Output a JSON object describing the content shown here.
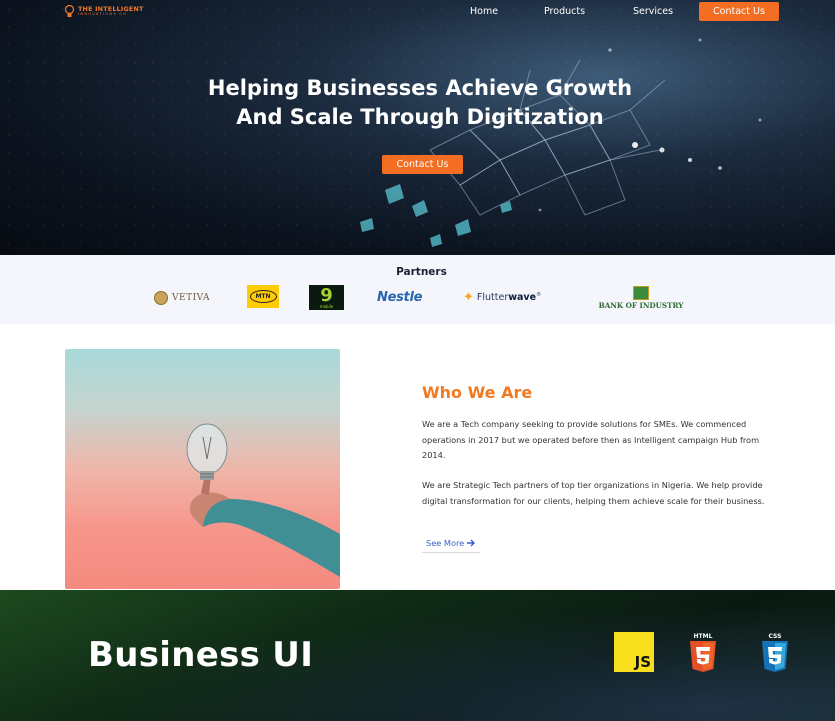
{
  "nav": {
    "logo_line1": "THE INTELLIGENT",
    "logo_line2": "INNOVATIONS CO",
    "links": [
      "Home",
      "Products",
      "Services"
    ],
    "cta": "Contact Us"
  },
  "hero": {
    "title_line1": "Helping Businesses Achieve Growth",
    "title_line2": "And Scale Through Digitization",
    "cta": "Contact Us"
  },
  "partners": {
    "title": "Partners",
    "logos": [
      {
        "name": "VETIVA"
      },
      {
        "name": "MTN"
      },
      {
        "name": "9",
        "sub": "mobile"
      },
      {
        "name": "Nestle"
      },
      {
        "name": "Flutter",
        "bold": "wave",
        "mark": "®"
      },
      {
        "name": "BANK OF INDUSTRY"
      }
    ]
  },
  "about": {
    "title": "Who We Are",
    "paragraph1": "We are a Tech company seeking to provide solutions for SMEs. We commenced operations in 2017 but we operated before then as Intelligent campaign Hub from 2014.",
    "paragraph2": "We are Strategic Tech partners of top tier organizations in Nigeria. We help provide digital transformation for our clients, helping them achieve scale for their business.",
    "see_more": "See More"
  },
  "banner": {
    "title": "Business UI",
    "tech": [
      {
        "name": "js-logo",
        "label": "JS"
      },
      {
        "name": "html5-logo",
        "label": "HTML"
      },
      {
        "name": "css3-logo",
        "label": "CSS"
      }
    ]
  },
  "colors": {
    "accent": "#f36e22",
    "link": "#3461c9",
    "hero_bg": "#0c1420",
    "banner_bg": "#102b16"
  }
}
